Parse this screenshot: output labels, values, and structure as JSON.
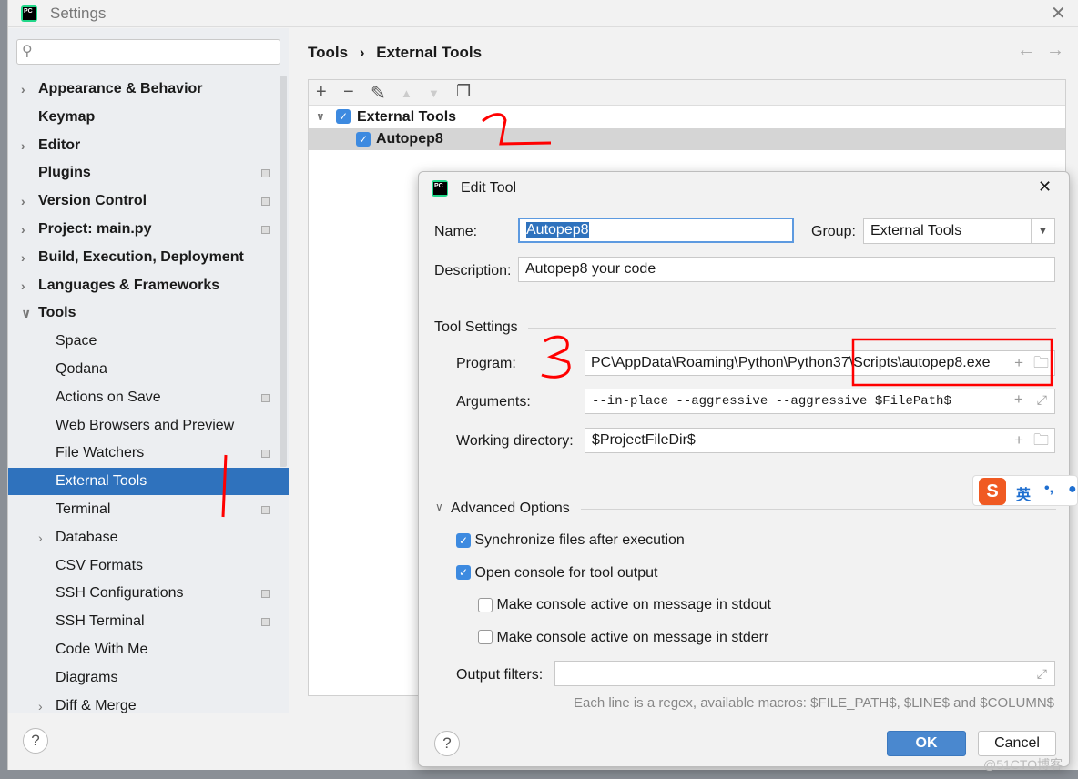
{
  "window": {
    "title": "Settings"
  },
  "sidebar": {
    "search_placeholder": "",
    "items": [
      {
        "label": "Appearance & Behavior",
        "bold": true,
        "expand": "collapsed"
      },
      {
        "label": "Keymap",
        "bold": true
      },
      {
        "label": "Editor",
        "bold": true,
        "expand": "collapsed"
      },
      {
        "label": "Plugins",
        "bold": true,
        "gear": true
      },
      {
        "label": "Version Control",
        "bold": true,
        "expand": "collapsed",
        "gear": true
      },
      {
        "label": "Project: main.py",
        "bold": true,
        "expand": "collapsed",
        "gear": true
      },
      {
        "label": "Build, Execution, Deployment",
        "bold": true,
        "expand": "collapsed"
      },
      {
        "label": "Languages & Frameworks",
        "bold": true,
        "expand": "collapsed"
      },
      {
        "label": "Tools",
        "bold": true,
        "expand": "expanded"
      },
      {
        "label": "Space",
        "child": true
      },
      {
        "label": "Qodana",
        "child": true
      },
      {
        "label": "Actions on Save",
        "child": true,
        "gear": true
      },
      {
        "label": "Web Browsers and Preview",
        "child": true
      },
      {
        "label": "File Watchers",
        "child": true,
        "gear": true
      },
      {
        "label": "External Tools",
        "child": true,
        "selected": true
      },
      {
        "label": "Terminal",
        "child": true,
        "gear": true
      },
      {
        "label": "Database",
        "child": true,
        "expand": "collapsed"
      },
      {
        "label": "CSV Formats",
        "child": true
      },
      {
        "label": "SSH Configurations",
        "child": true,
        "gear": true
      },
      {
        "label": "SSH Terminal",
        "child": true,
        "gear": true
      },
      {
        "label": "Code With Me",
        "child": true
      },
      {
        "label": "Diagrams",
        "child": true
      },
      {
        "label": "Diff & Merge",
        "child": true,
        "expand": "collapsed"
      }
    ]
  },
  "breadcrumb": {
    "parent": "Tools",
    "sep": "›",
    "current": "External Tools"
  },
  "nav": {
    "back": "←",
    "forward": "→"
  },
  "toolbar": {
    "add": "+",
    "remove": "−",
    "edit": "✎",
    "up": "▲",
    "down": "▼",
    "copy": "❐"
  },
  "tree": {
    "group": {
      "label": "External Tools",
      "checked": true
    },
    "tool": {
      "label": "Autopep8",
      "checked": true
    }
  },
  "help": "?",
  "dialog": {
    "title": "Edit Tool",
    "close": "✕",
    "name_label": "Name:",
    "name_value": "Autopep8",
    "group_label": "Group:",
    "group_value": "External Tools",
    "description_label": "Description:",
    "description_value": "Autopep8 your code",
    "tool_settings": "Tool Settings",
    "program_label": "Program:",
    "program_value": "PC\\AppData\\Roaming\\Python\\Python37\\Scripts\\autopep8.exe",
    "arguments_label": "Arguments:",
    "arguments_value": "--in-place --aggressive --aggressive $FilePath$",
    "workdir_label": "Working directory:",
    "workdir_value": "$ProjectFileDir$",
    "advanced": "Advanced Options",
    "options": [
      {
        "label": "Synchronize files after execution",
        "checked": true
      },
      {
        "label": "Open console for tool output",
        "checked": true
      },
      {
        "label": "Make console active on message in stdout",
        "checked": false
      },
      {
        "label": "Make console active on message in stderr",
        "checked": false
      }
    ],
    "output_filters_label": "Output filters:",
    "output_filters_value": "",
    "hint": "Each line is a regex, available macros: $FILE_PATH$, $LINE$ and $COLUMN$",
    "ok": "OK",
    "cancel": "Cancel"
  },
  "ime": {
    "logo": "S",
    "lang": "英",
    "punct": "•,"
  },
  "annotations": [
    "1",
    "2",
    "3"
  ],
  "watermark": "@51CTO博客",
  "colors": {
    "selection": "#2f72bd",
    "checkbox": "#3d8ae0",
    "ok_button": "#4a88cf",
    "annotation": "#ff0000"
  }
}
